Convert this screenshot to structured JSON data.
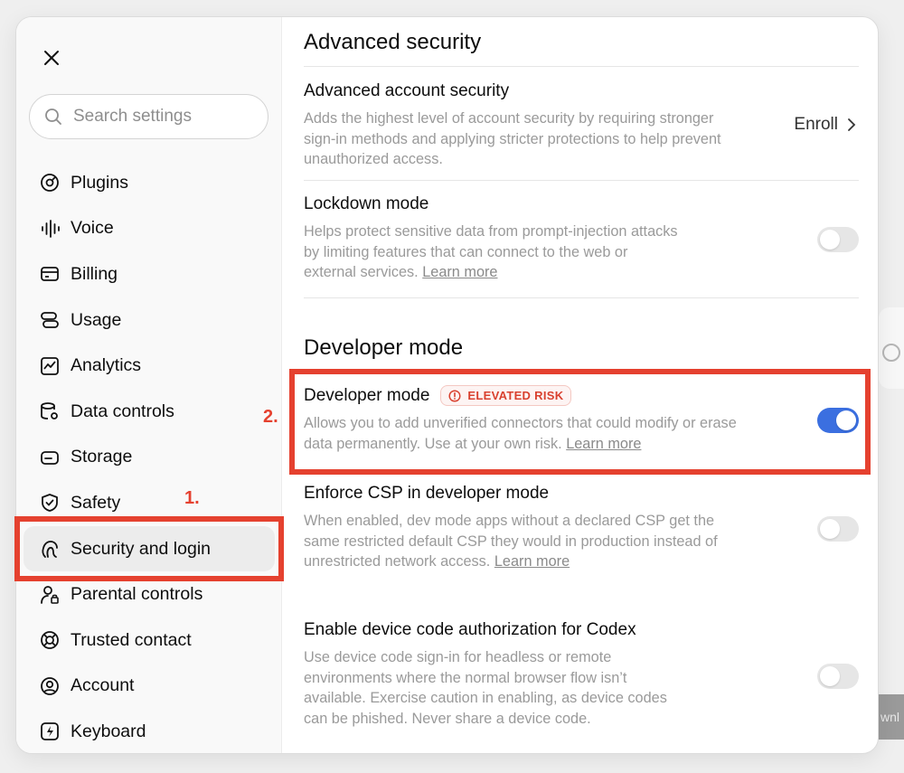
{
  "sidebar": {
    "search_placeholder": "Search settings",
    "items": [
      {
        "label": "Plugins",
        "icon": "plugin-icon"
      },
      {
        "label": "Voice",
        "icon": "waveform-icon"
      },
      {
        "label": "Billing",
        "icon": "credit-card-icon"
      },
      {
        "label": "Usage",
        "icon": "usage-icon"
      },
      {
        "label": "Analytics",
        "icon": "chart-icon"
      },
      {
        "label": "Data controls",
        "icon": "database-gear-icon"
      },
      {
        "label": "Storage",
        "icon": "storage-icon"
      },
      {
        "label": "Safety",
        "icon": "shield-check-icon"
      },
      {
        "label": "Security and login",
        "icon": "security-key-icon"
      },
      {
        "label": "Parental controls",
        "icon": "parental-icon"
      },
      {
        "label": "Trusted contact",
        "icon": "lifebuoy-icon"
      },
      {
        "label": "Account",
        "icon": "account-icon"
      },
      {
        "label": "Keyboard",
        "icon": "keyboard-icon"
      }
    ],
    "active_item": "Security and login"
  },
  "annotations": {
    "step1": "1.",
    "step2": "2.",
    "color": "#e5412f"
  },
  "main": {
    "advanced_security": {
      "title": "Advanced security",
      "account_security": {
        "title": "Advanced account security",
        "description": "Adds the highest level of account security by requiring stronger sign-in methods and applying stricter protections to help prevent unauthorized access.",
        "action": "Enroll"
      },
      "lockdown": {
        "title": "Lockdown mode",
        "description": "Helps protect sensitive data from prompt-injection attacks by limiting features that can connect to the web or external services.",
        "link": "Learn more",
        "enabled": false
      }
    },
    "developer_mode": {
      "title": "Developer mode",
      "dev_mode": {
        "title": "Developer mode",
        "badge": "ELEVATED RISK",
        "description": "Allows you to add unverified connectors that could modify or erase data permanently. Use at your own risk.",
        "link": "Learn more",
        "enabled": true
      },
      "csp": {
        "title": "Enforce CSP in developer mode",
        "description": "When enabled, dev mode apps without a declared CSP get the same restricted default CSP they would in production instead of unrestricted network access.",
        "link": "Learn more",
        "enabled": false
      },
      "device_code": {
        "title": "Enable device code authorization for Codex",
        "description": "Use device code sign-in for headless or remote environments where the normal browser flow isn’t available. Exercise caution in enabling, as device codes can be phished. Never share a device code.",
        "enabled": false
      }
    }
  },
  "background": {
    "button_fragment": "wnl"
  },
  "colors": {
    "toggle_on": "#3b6fe0",
    "risk": "#d9412f"
  }
}
